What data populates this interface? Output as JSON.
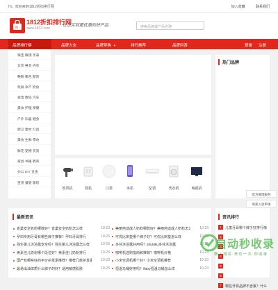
{
  "topbar": {
    "welcome": "Hi，欢迎来到1812折扣排行网",
    "join": "加入收藏",
    "contact": "联系我们"
  },
  "header": {
    "brand": "1812折扣排行网",
    "url": "www.1812.com",
    "slogan": "让您买到更优惠的好产品",
    "search_placeholder": "搜索品牌或产品名称"
  },
  "nav": {
    "category": "品牌排行榜",
    "items": [
      "品牌大全",
      "品牌导购",
      "排行推荐",
      "品牌问答"
    ],
    "login": "登录",
    "register": "注册"
  },
  "sidebar": {
    "items": [
      "珠宝 眼镜 手表",
      "女装 男装 内衣",
      "鞋靴 箱包 配饰",
      "玩具 孕产 奶食",
      "家电 数码 汽车",
      "美妆 护理 保健",
      "户外 乐器 健身",
      "厨卫 建材 灯具",
      "美食 生鲜 零食",
      "鲜花 宠物 农资",
      "家具 书籍 教育",
      "办公 DIY 五金",
      "百货 餐厨 家纺"
    ]
  },
  "hot_brand": {
    "title": "热门品牌"
  },
  "products": [
    {
      "label": "吹风机",
      "icon": "hair-dryer-icon"
    },
    {
      "label": "耳机",
      "icon": "earphone-icon"
    },
    {
      "label": "口罩",
      "icon": "mask-icon"
    },
    {
      "label": "手机",
      "icon": "phone-icon"
    },
    {
      "label": "空调",
      "icon": "air-conditioner-icon"
    },
    {
      "label": "洗衣机",
      "icon": "washing-machine-icon"
    },
    {
      "label": "电视机",
      "icon": "tv-icon"
    }
  ],
  "side_buttons": [
    "官方微博服务",
    "商家入驻申请",
    "微信公众号"
  ],
  "news": {
    "title": "最新资讯",
    "left": [
      {
        "title": "雀巢安全奶粉哪款好？雀巢安全奶粉怎么样",
        "date": "10-23"
      },
      {
        "title": "孕妇专用牙膏有哪些牌子推荐？孕妇牙膏排行",
        "date": "10-23"
      },
      {
        "title": "强生婴儿沐浴露安全吗？强生婴儿沐浴露怎么样",
        "date": "10-23"
      },
      {
        "title": "美素佳儿奶粉哪个段位好？美素佳儿奶粉排行",
        "date": "10-23"
      },
      {
        "title": "国产有哪些好的平价护发素推荐？推荐几款护发素",
        "date": "10-23"
      },
      {
        "title": "最易出油体质什么牌子的好？适用敏感肌肤",
        "date": "10-23"
      }
    ],
    "right": [
      {
        "title": "美丽芭迪成人奶粉哪款好？美丽芭迪成人奶粉怎么样",
        "date": "10-23"
      },
      {
        "title": "可优比床垫哪个牌子好？可优比床垫怎么样",
        "date": "10-23"
      },
      {
        "title": "多芬沐浴露好用吗？shukiku多芬沐浴露",
        "date": "10-23"
      },
      {
        "title": "咖啡机选购指南和推荐？咖啡机价格",
        "date": "10-23"
      },
      {
        "title": "小米空调机哪个好？小米空调机推荐",
        "date": "10-23"
      },
      {
        "title": "恒温马桶好用吗？ifaby恒温马桶怎么样",
        "date": "10-23"
      }
    ]
  },
  "rank": {
    "title": "资讯排行",
    "items": [
      "儿童牙膏哪个牌子好排行榜",
      "",
      "",
      "",
      "",
      "",
      "哪些牙膏品牌不含氟？什么"
    ]
  },
  "watermark": {
    "main": "自动秒收录",
    "sub": "做上排名·来访一次·秒收录"
  }
}
